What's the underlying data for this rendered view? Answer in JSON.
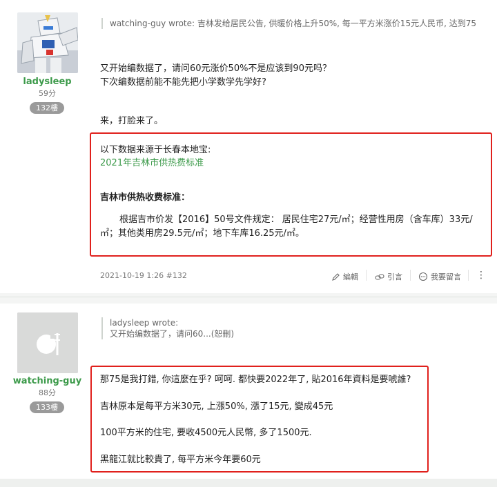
{
  "post1": {
    "username": "ladysleep",
    "points": "59分",
    "floor": "132樓",
    "quote": "watching-guy wrote: 吉林发给居民公告, 供暖价格上升50%, 每一平方米涨价15元人民币, 达到75",
    "lines": [
      "又开始编数据了，请问60元涨价50%不是应该到90元吗？",
      "下次编数据前能不能先把小学数学先学好?",
      "来，打脸来了。"
    ],
    "box": {
      "source": "以下数据来源于长春本地宝:",
      "link": "2021年吉林市供热费标准",
      "heading": "吉林市供热收费标准：",
      "body1": "根据吉市价发【2016】50号文件规定： 居民住宅27元/㎡；经营性用房（含车库）33元/",
      "body2": "㎡；其他类用房29.5元/㎡；地下车库16.25元/㎡。"
    },
    "timestamp": "2021-10-19 1:26 #132",
    "actions": {
      "edit": "編輯",
      "quote": "引言",
      "reply": "我要留言",
      "more": "⋮"
    }
  },
  "post2": {
    "username": "watching-guy",
    "points": "88分",
    "floor": "133樓",
    "quote_author": "ladysleep wrote:",
    "quote_text": "又开始编数据了，请问60...(恕刪)",
    "lines": [
      "那75是我打錯, 你這麼在乎? 呵呵. 都快要2022年了, 貼2016年資料是要唬誰?",
      "吉林原本是每平方米30元, 上漲50%, 漲了15元, 變成45元",
      "100平方米的住宅, 要收4500元人民幣, 多了1500元.",
      "黑龍江就比較貴了, 每平方米今年要60元"
    ]
  },
  "colors": {
    "accent": "#3c9a4a",
    "highlight_border": "#e0201c"
  }
}
